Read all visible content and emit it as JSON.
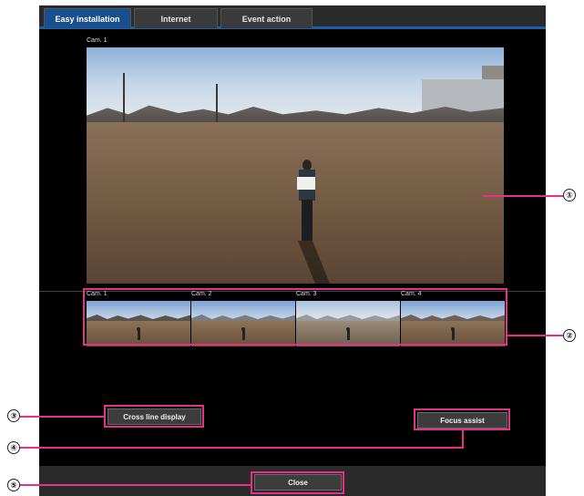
{
  "tabs": [
    {
      "label": "Easy installation",
      "active": true
    },
    {
      "label": "Internet",
      "active": false
    },
    {
      "label": "Event action",
      "active": false
    }
  ],
  "main_view": {
    "label": "Cam. 1"
  },
  "thumbnails": [
    {
      "label": "Cam. 1"
    },
    {
      "label": "Cam. 2"
    },
    {
      "label": "Cam. 3"
    },
    {
      "label": "Cam. 4"
    }
  ],
  "buttons": {
    "cross_line": "Cross line display",
    "focus_assist": "Focus assist",
    "close": "Close"
  },
  "callouts": [
    "①",
    "②",
    "③",
    "④",
    "⑤"
  ],
  "colors": {
    "highlight": "#e8308a",
    "tab_active": "#1a4f8e",
    "panel": "#000000"
  }
}
